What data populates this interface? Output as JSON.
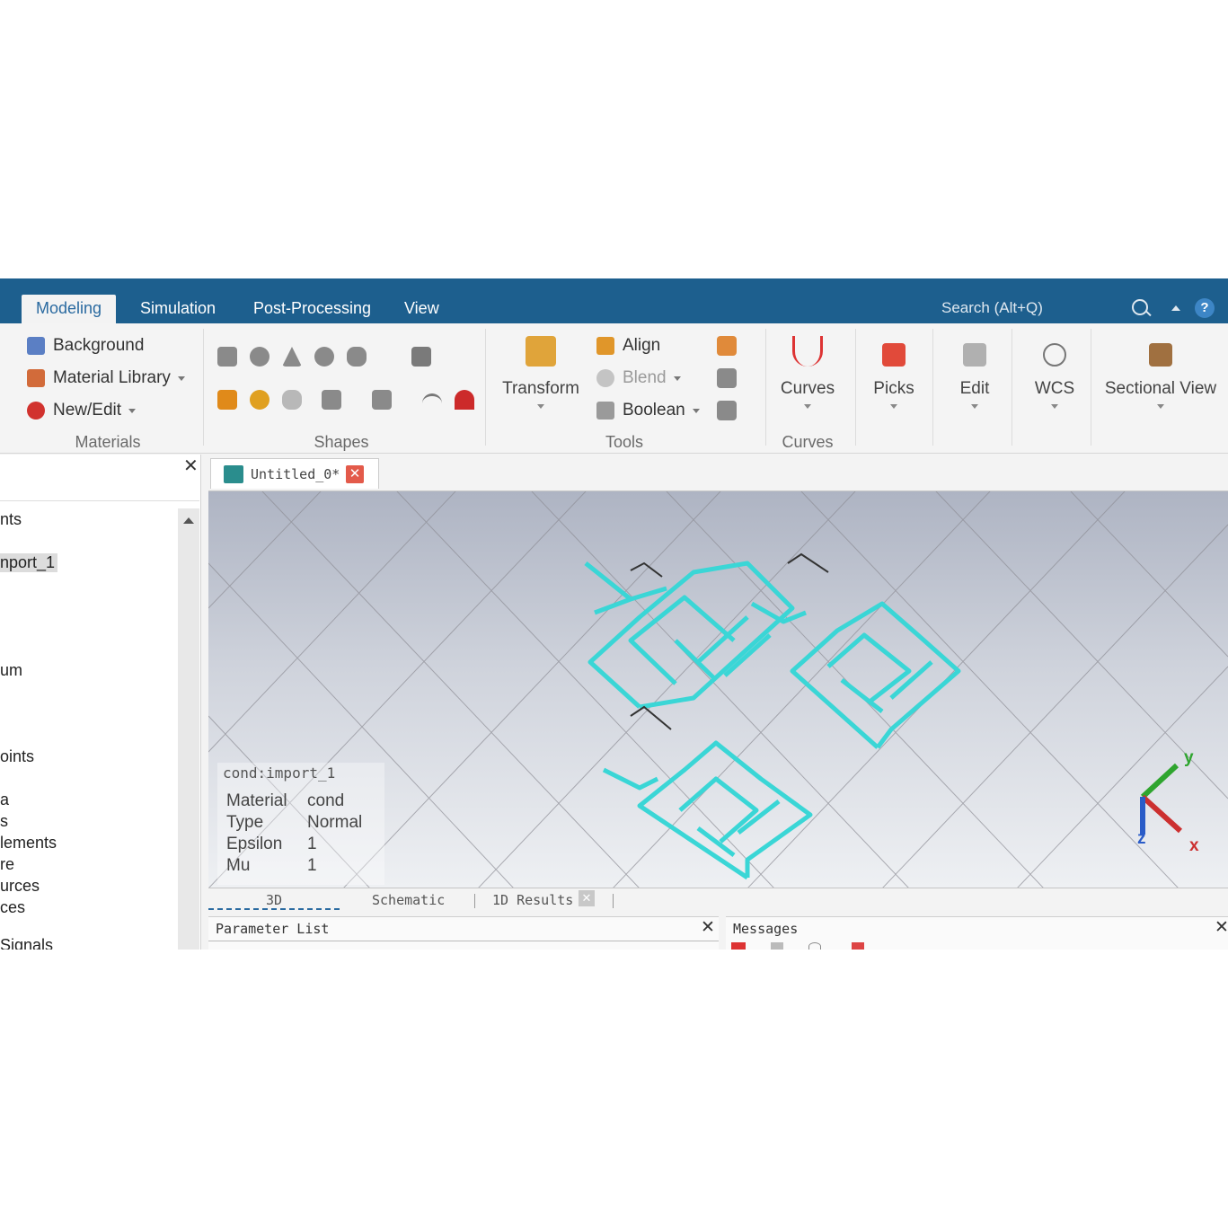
{
  "menubar": {
    "tabs": [
      {
        "label": "Modeling",
        "active": true
      },
      {
        "label": "Simulation",
        "active": false
      },
      {
        "label": "Post-Processing",
        "active": false
      },
      {
        "label": "View",
        "active": false
      }
    ],
    "search_placeholder": "Search (Alt+Q)",
    "help": "?"
  },
  "ribbon": {
    "materials": {
      "background": "Background",
      "material_library": "Material Library",
      "new_edit": "New/Edit",
      "group": "Materials"
    },
    "shapes": {
      "group": "Shapes"
    },
    "tools": {
      "transform": "Transform",
      "align": "Align",
      "blend": "Blend",
      "boolean": "Boolean",
      "group": "Tools"
    },
    "curves": {
      "curves": "Curves",
      "group": "Curves"
    },
    "picks": "Picks",
    "edit": "Edit",
    "wcs": "WCS",
    "sectional_view": "Sectional View"
  },
  "tree": {
    "items": [
      "nts",
      "nport_1",
      "um",
      "oints",
      "a",
      "s",
      "lements",
      "re",
      "urces",
      "ces",
      "Signals"
    ]
  },
  "document": {
    "tab_label": "Untitled_0*"
  },
  "viewport": {
    "info": {
      "title": "cond:import_1",
      "rows": [
        {
          "key": "Material",
          "value": "cond"
        },
        {
          "key": "Type",
          "value": "Normal"
        },
        {
          "key": "Epsilon",
          "value": "1"
        },
        {
          "key": "Mu",
          "value": "1"
        }
      ]
    },
    "axes": {
      "x": "x",
      "y": "y",
      "z": "z"
    }
  },
  "view_tabs": [
    "3D",
    "Schematic",
    "1D Results"
  ],
  "panels": {
    "parameter_list": "Parameter List",
    "messages": "Messages"
  },
  "colors": {
    "accent": "#1d5f8e",
    "model": "#3ad6d6",
    "close": "#e35a4a"
  }
}
